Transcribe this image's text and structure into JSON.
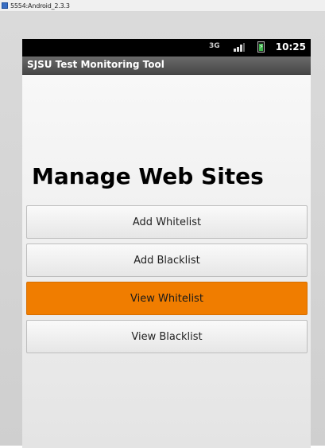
{
  "emulator": {
    "window_title": "5554:Android_2.3.3"
  },
  "status_bar": {
    "network": "3G",
    "time": "10:25"
  },
  "app": {
    "title": "SJSU Test Monitoring Tool"
  },
  "main": {
    "heading": "Manage Web Sites",
    "buttons": [
      {
        "label": "Add Whitelist",
        "state": "normal"
      },
      {
        "label": "Add Blacklist",
        "state": "normal"
      },
      {
        "label": "View Whitelist",
        "state": "pressed"
      },
      {
        "label": "View Blacklist",
        "state": "normal"
      }
    ]
  },
  "colors": {
    "pressed_button": "#f07d00",
    "title_bar": "#555555",
    "status_bar": "#000000",
    "battery": "#3db84a"
  },
  "icons": [
    "app-icon",
    "3g-icon",
    "signal-icon",
    "battery-icon"
  ]
}
